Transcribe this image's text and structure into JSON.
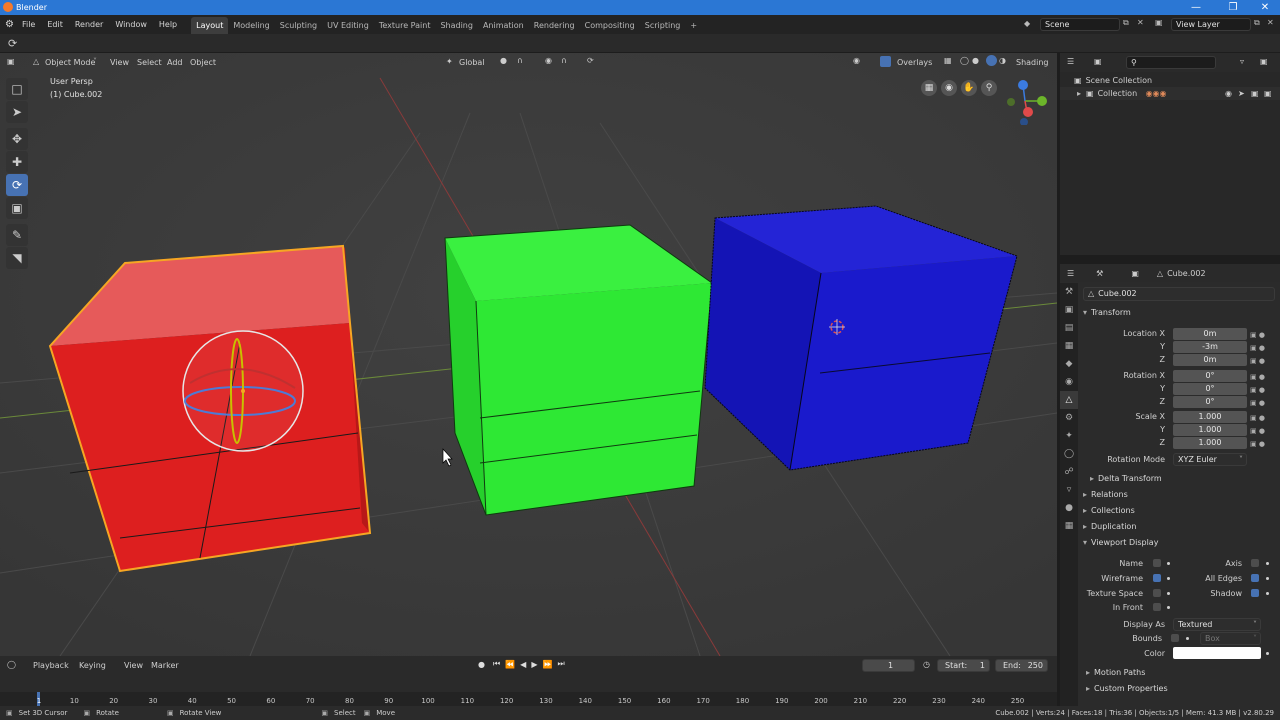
{
  "window": {
    "title": "Blender"
  },
  "menubar": {
    "items": [
      "File",
      "Edit",
      "Render",
      "Window",
      "Help"
    ]
  },
  "workspaces": {
    "tabs": [
      "Layout",
      "Modeling",
      "Sculpting",
      "UV Editing",
      "Texture Paint",
      "Shading",
      "Animation",
      "Rendering",
      "Compositing",
      "Scripting"
    ],
    "active": "Layout",
    "add": "+"
  },
  "scene": {
    "name": "Scene",
    "view_layer": "View Layer"
  },
  "viewport_header": {
    "mode": "Object Mode",
    "menus": [
      "View",
      "Select",
      "Add",
      "Object"
    ],
    "orientation": "Global",
    "overlays": "Overlays",
    "shading": "Shading"
  },
  "viewport": {
    "view_name": "User Persp",
    "object_info": "(1) Cube.002",
    "colors": {
      "red": "#dd1f1f",
      "green": "#2ee834",
      "blue": "#1a1acc",
      "background": "#3c3c3c"
    }
  },
  "toolbar": {
    "tools": [
      "select-box-icon",
      "cursor-icon",
      "move-icon",
      "move-arrows-icon",
      "rotate-icon",
      "scale-icon",
      "annotate-icon",
      "measure-icon"
    ],
    "active": "rotate-icon"
  },
  "outliner": {
    "root": "Scene Collection",
    "collection": "Collection"
  },
  "properties": {
    "header_object": "Cube.002",
    "object_name": "Cube.002",
    "transform_label": "Transform",
    "location": {
      "label_x": "Location X",
      "label_y": "Y",
      "label_z": "Z",
      "x": "0m",
      "y": "-3m",
      "z": "0m"
    },
    "rotation": {
      "label_x": "Rotation X",
      "label_y": "Y",
      "label_z": "Z",
      "x": "0°",
      "y": "0°",
      "z": "0°"
    },
    "scale": {
      "label_x": "Scale X",
      "label_y": "Y",
      "label_z": "Z",
      "x": "1.000",
      "y": "1.000",
      "z": "1.000"
    },
    "rotation_mode_label": "Rotation Mode",
    "rotation_mode": "XYZ Euler",
    "panels": [
      "Delta Transform",
      "Relations",
      "Collections",
      "Duplication",
      "Viewport Display"
    ],
    "viewport_display": {
      "name": "Name",
      "axis": "Axis",
      "wireframe": "Wireframe",
      "all_edges": "All Edges",
      "texture_space": "Texture Space",
      "shadow": "Shadow",
      "in_front": "In Front",
      "display_as_label": "Display As",
      "display_as": "Textured",
      "bounds_label": "Bounds",
      "bounds_value": "Box",
      "color_label": "Color",
      "color_value": "#ffffff",
      "checked": {
        "name": false,
        "axis": false,
        "wireframe": true,
        "all_edges": true,
        "texture_space": false,
        "shadow": true,
        "in_front": false,
        "bounds": false
      }
    },
    "panels_bottom": [
      "Motion Paths",
      "Custom Properties"
    ]
  },
  "timeline": {
    "menus": [
      "Playback",
      "Keying",
      "View",
      "Marker"
    ],
    "current_frame": "1",
    "start_label": "Start:",
    "start": "1",
    "end_label": "End:",
    "end": "250",
    "ticks": [
      "1",
      "10",
      "20",
      "30",
      "40",
      "50",
      "60",
      "70",
      "80",
      "90",
      "100",
      "110",
      "120",
      "130",
      "140",
      "150",
      "160",
      "170",
      "180",
      "190",
      "200",
      "210",
      "220",
      "230",
      "240",
      "250"
    ]
  },
  "statusbar": {
    "left": [
      "Set 3D Cursor",
      "Rotate",
      "Rotate View",
      "Select",
      "Move"
    ],
    "right": "Cube.002 | Verts:24 | Faces:18 | Tris:36 | Objects:1/5 | Mem: 41.3 MB | v2.80.29"
  }
}
